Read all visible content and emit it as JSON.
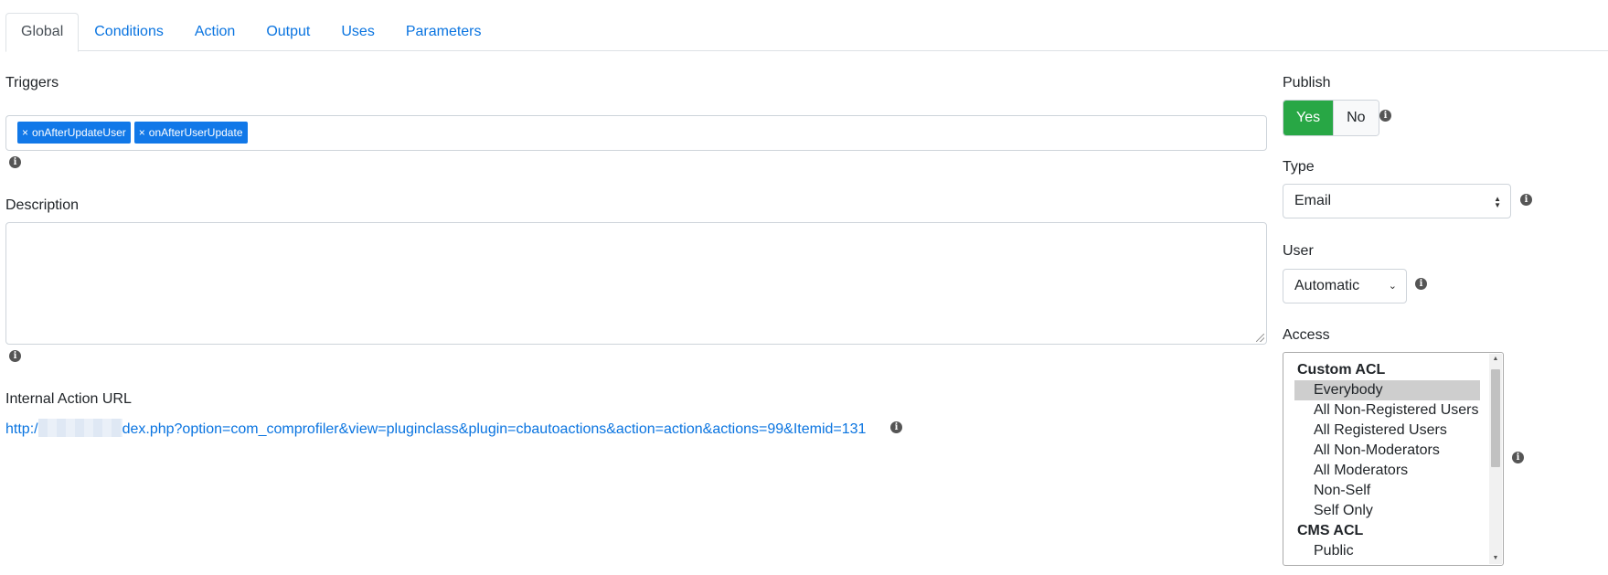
{
  "tabs": [
    "Global",
    "Conditions",
    "Action",
    "Output",
    "Uses",
    "Parameters"
  ],
  "triggers": {
    "label": "Triggers",
    "tags": [
      "onAfterUpdateUser",
      "onAfterUserUpdate"
    ],
    "remove_glyph": "×"
  },
  "description": {
    "label": "Description",
    "value": ""
  },
  "internal_url": {
    "label": "Internal Action URL",
    "prefix": "http:/",
    "suffix": "dex.php?option=com_comprofiler&view=pluginclass&plugin=cbautoactions&action=action&actions=99&Itemid=131"
  },
  "publish": {
    "label": "Publish",
    "yes": "Yes",
    "no": "No",
    "selected": "Yes"
  },
  "type": {
    "label": "Type",
    "value": "Email"
  },
  "user": {
    "label": "User",
    "value": "Automatic"
  },
  "access": {
    "label": "Access",
    "groups": [
      {
        "name": "Custom ACL",
        "options": [
          "Everybody",
          "All Non-Registered Users",
          "All Registered Users",
          "All Non-Moderators",
          "All Moderators",
          "Non-Self",
          "Self Only"
        ]
      },
      {
        "name": "CMS ACL",
        "options": [
          "Public"
        ]
      }
    ],
    "selected": "Everybody"
  },
  "info_glyph": "i",
  "colors": {
    "link": "#0a74e0",
    "tag": "#1178e8",
    "yes": "#28a745"
  }
}
